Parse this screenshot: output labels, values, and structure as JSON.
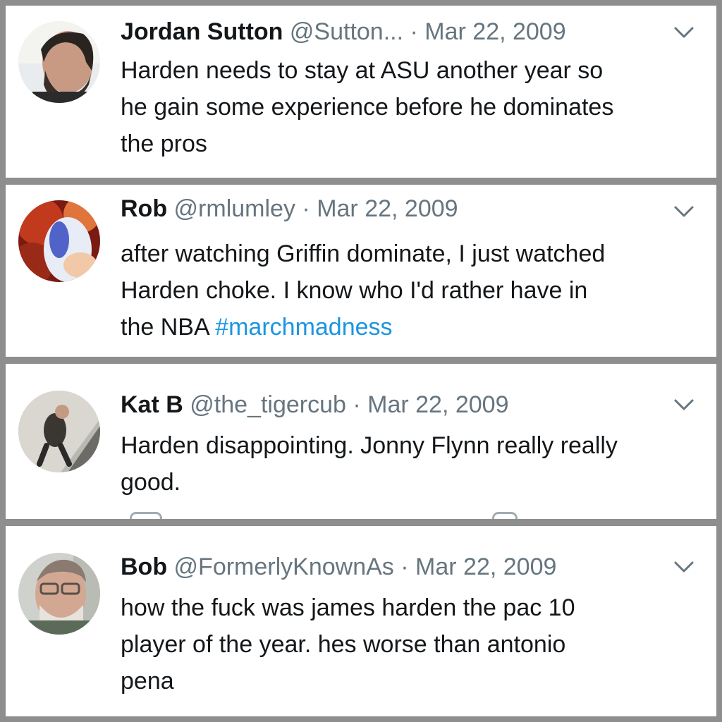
{
  "tweets": [
    {
      "name": "Jordan Sutton",
      "handle": "@Sutton...",
      "separator": "·",
      "date": "Mar 22, 2009",
      "text": "Harden needs to stay at ASU another year so\nhe gain some experience before he dominates\nthe pros"
    },
    {
      "name": "Rob",
      "handle": "@rmlumley",
      "separator": "·",
      "date": "Mar 22, 2009",
      "text": "after watching Griffin dominate, I just watched\nHarden choke.  I know who I'd rather have in\nthe NBA ",
      "hashtag": "#marchmadness"
    },
    {
      "name": "Kat B",
      "handle": "@the_tigercub",
      "separator": "·",
      "date": "Mar 22, 2009",
      "text": "Harden disappointing. Jonny Flynn really really\ngood."
    },
    {
      "name": "Bob",
      "handle": "@FormerlyKnownAs",
      "separator": "·",
      "date": "Mar 22, 2009",
      "text": "how the fuck was james harden the pac 10\nplayer of the year. hes worse than antonio\npena"
    }
  ],
  "colors": {
    "name": "#14171a",
    "meta": "#66757f",
    "hashtag": "#1b95e0",
    "divider": "#8e8e8e"
  },
  "icons": {
    "menu": "chevron-down-icon"
  }
}
